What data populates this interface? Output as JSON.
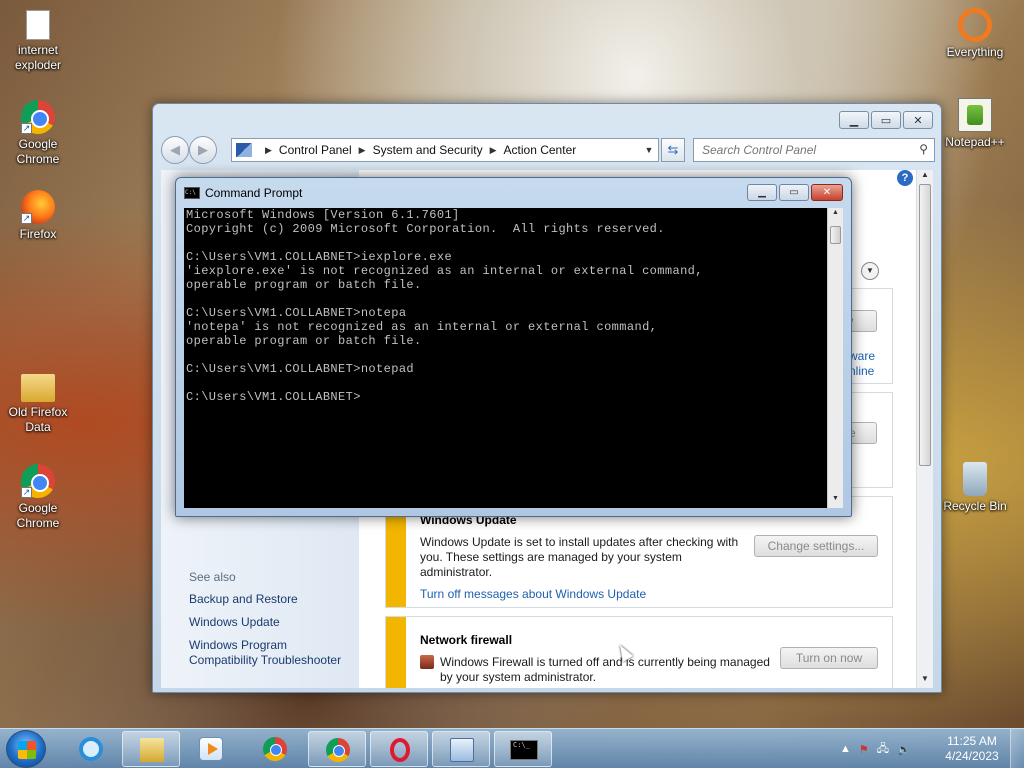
{
  "desktop": {
    "icons": [
      {
        "label": "internet exploder",
        "icon": "document-icon"
      },
      {
        "label": "Google Chrome",
        "icon": "chrome-icon"
      },
      {
        "label": "Firefox",
        "icon": "firefox-icon"
      },
      {
        "label": "Old Firefox Data",
        "icon": "folder-icon"
      },
      {
        "label": "Google Chrome",
        "icon": "chrome-icon"
      },
      {
        "label": "Everything",
        "icon": "everything-icon"
      },
      {
        "label": "Notepad++",
        "icon": "notepadpp-icon"
      },
      {
        "label": "Recycle Bin",
        "icon": "recycle-bin-icon"
      }
    ]
  },
  "control_panel": {
    "breadcrumb": [
      "Control Panel",
      "System and Security",
      "Action Center"
    ],
    "search_placeholder": "Search Control Panel",
    "see_also_label": "See also",
    "see_also_links": [
      "Backup and Restore",
      "Windows Update",
      "Windows Program Compatibility Troubleshooter"
    ],
    "partial_texts": {
      "button1": "w",
      "link1": "ware",
      "link2": "nline",
      "button2": "ne"
    },
    "windows_update": {
      "title": "Windows Update",
      "text": "Windows Update is set to install updates after checking with you.  These settings are managed by your system administrator.",
      "link": "Turn off messages about Windows Update",
      "button": "Change settings..."
    },
    "network_firewall": {
      "title": "Network firewall",
      "text": "Windows Firewall is turned off and is currently being managed by your system administrator.",
      "button": "Turn on now"
    },
    "accent_color": "#f2b600"
  },
  "cmd": {
    "title": "Command Prompt",
    "lines": [
      "Microsoft Windows [Version 6.1.7601]",
      "Copyright (c) 2009 Microsoft Corporation.  All rights reserved.",
      "",
      "C:\\Users\\VM1.COLLABNET>iexplore.exe",
      "'iexplore.exe' is not recognized as an internal or external command,",
      "operable program or batch file.",
      "",
      "C:\\Users\\VM1.COLLABNET>notepa",
      "'notepa' is not recognized as an internal or external command,",
      "operable program or batch file.",
      "",
      "C:\\Users\\VM1.COLLABNET>notepad",
      "",
      "C:\\Users\\VM1.COLLABNET>"
    ]
  },
  "taskbar": {
    "items": [
      "internet-explorer-icon",
      "file-explorer-icon",
      "media-center-icon",
      "chrome-icon",
      "chrome-icon",
      "opera-icon",
      "control-panel-icon",
      "command-prompt-icon"
    ],
    "clock_time": "11:25 AM",
    "clock_date": "4/24/2023"
  }
}
